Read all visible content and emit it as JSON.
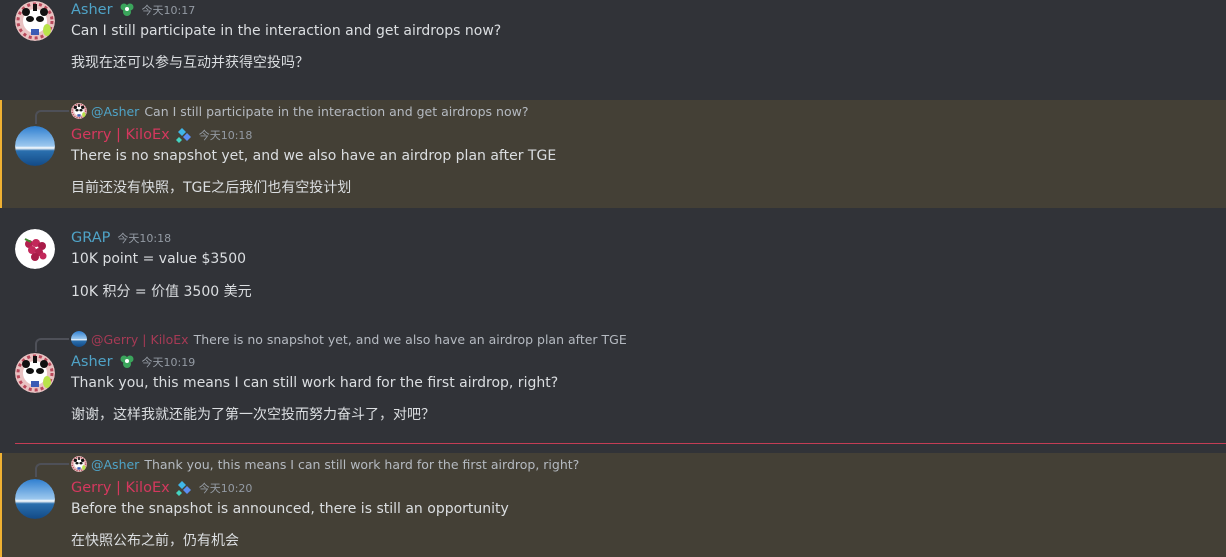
{
  "messages": [
    {
      "author": "Asher",
      "timestamp": "今天10:17",
      "lines": [
        "Can I still participate in the interaction and get airdrops now?",
        "我现在还可以参与互动并获得空投吗？"
      ]
    },
    {
      "author": "Gerry | KiloEx",
      "timestamp": "今天10:18",
      "highlighted": true,
      "reply": {
        "mention": "@Asher",
        "text": "Can I still participate in the interaction and get airdrops now?"
      },
      "lines": [
        "There is no snapshot yet, and we also have an airdrop plan after TGE",
        "目前还没有快照，TGE之后我们也有空投计划"
      ]
    },
    {
      "author": "GRAP",
      "timestamp": "今天10:18",
      "lines": [
        "10K point = value $3500",
        "10K 积分 = 价值 3500 美元"
      ]
    },
    {
      "author": "Asher",
      "timestamp": "今天10:19",
      "reply": {
        "mention": "@Gerry | KiloEx",
        "text": "There is no snapshot yet, and we also have an airdrop plan after TGE"
      },
      "lines": [
        "Thank you, this means I can still work hard for the first airdrop, right?",
        "谢谢，这样我就还能为了第一次空投而努力奋斗了，对吧？"
      ]
    },
    {
      "author": "Gerry | KiloEx",
      "timestamp": "今天10:20",
      "highlighted": true,
      "reply": {
        "mention": "@Asher",
        "text": "Thank you, this means I can still work hard for the first airdrop, right?"
      },
      "lines": [
        "Before the snapshot is announced, there is still an opportunity",
        "在快照公布之前，仍有机会"
      ]
    }
  ],
  "colors": {
    "background": "#313338",
    "highlight": "#444036",
    "highlight_bar": "#f0b132",
    "asher_name": "#4fa3c7",
    "gerry_name": "#d4385e",
    "new_divider": "#c43d55"
  }
}
